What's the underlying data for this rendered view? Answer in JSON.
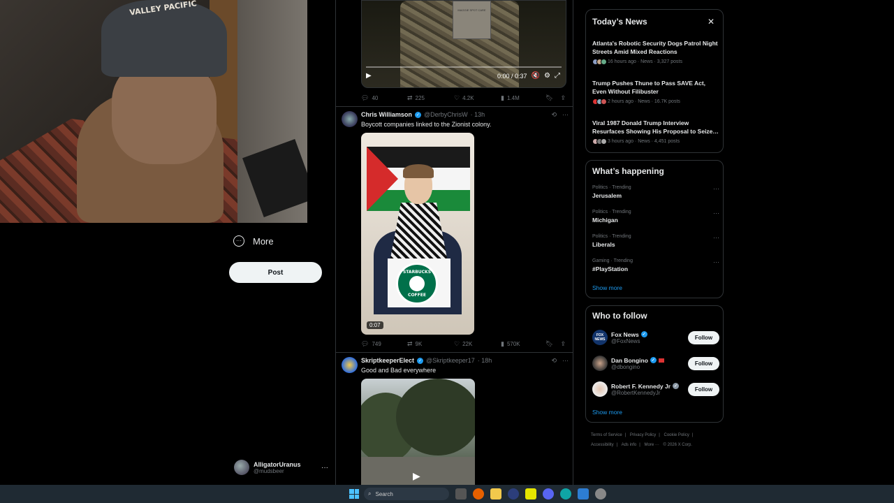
{
  "left_nav": {
    "more_label": "More",
    "post_label": "Post",
    "account": {
      "display_name": "AlligatorUranus",
      "handle": "@mudsbeer",
      "menu": "···"
    }
  },
  "webcam": {
    "hat_text": "VALLEY PACIFIC"
  },
  "timeline": {
    "tweet0": {
      "video_time": "0:00 / 0:37",
      "book_text": "MAGGIE SPOT CARE",
      "replies": "40",
      "reposts": "225",
      "likes": "4.2K",
      "views": "1.4M"
    },
    "tweet1": {
      "name": "Chris Williamson",
      "handle": "@DerbyChrisW",
      "time": "· 13h",
      "text": "Boycott companies linked to the Zionist colony.",
      "media_duration": "0:07",
      "starbucks_top": "STARBUCKS",
      "starbucks_bottom": "COFFEE",
      "replies": "749",
      "reposts": "9K",
      "likes": "22K",
      "views": "570K"
    },
    "tweet2": {
      "name": "SkriptkeeperElect",
      "handle": "@Skriptkeeper17",
      "time": "· 18h",
      "text": "Good and Bad everywhere"
    }
  },
  "todays_news": {
    "title": "Today’s News",
    "close": "✕",
    "items": [
      {
        "headline": "Atlanta's Robotic Security Dogs Patrol Night Streets Amid Mixed Reactions",
        "meta": "16 hours ago · News · 3,327 posts"
      },
      {
        "headline": "Trump Pushes Thune to Pass SAVE Act, Even Without Filibuster",
        "meta": "2 hours ago · News · 16.7K posts"
      },
      {
        "headline": "Viral 1987 Donald Trump Interview Resurfaces Showing His Proposal to Seize…",
        "meta": "3 hours ago · News · 4,451 posts"
      }
    ]
  },
  "whats_happening": {
    "title": "What’s happening",
    "items": [
      {
        "category": "Politics · Trending",
        "topic": "Jerusalem"
      },
      {
        "category": "Politics · Trending",
        "topic": "Michigan"
      },
      {
        "category": "Politics · Trending",
        "topic": "Liberals"
      },
      {
        "category": "Gaming · Trending",
        "topic": "#PlayStation"
      }
    ],
    "show_more": "Show more"
  },
  "who_to_follow": {
    "title": "Who to follow",
    "items": [
      {
        "name": "Fox News",
        "handle": "@FoxNews",
        "button": "Follow",
        "avatar_text": "FOX NEWS"
      },
      {
        "name": "Dan Bongino",
        "handle": "@dbongino",
        "button": "Follow"
      },
      {
        "name": "Robert F. Kennedy Jr",
        "handle": "@RobertKennedyJr",
        "button": "Follow"
      }
    ],
    "show_more": "Show more"
  },
  "footer": {
    "links": [
      "Terms of Service",
      "|",
      "Privacy Policy",
      "|",
      "Cookie Policy",
      "|",
      "Accessibility",
      "|",
      "Ads info",
      "|",
      "More ···",
      "© 2026 X Corp."
    ]
  },
  "taskbar": {
    "search_placeholder": "Search"
  },
  "colors": {
    "accent": "#1d9bf0",
    "background": "#000000",
    "border": "#2f3336",
    "muted": "#71767b"
  }
}
